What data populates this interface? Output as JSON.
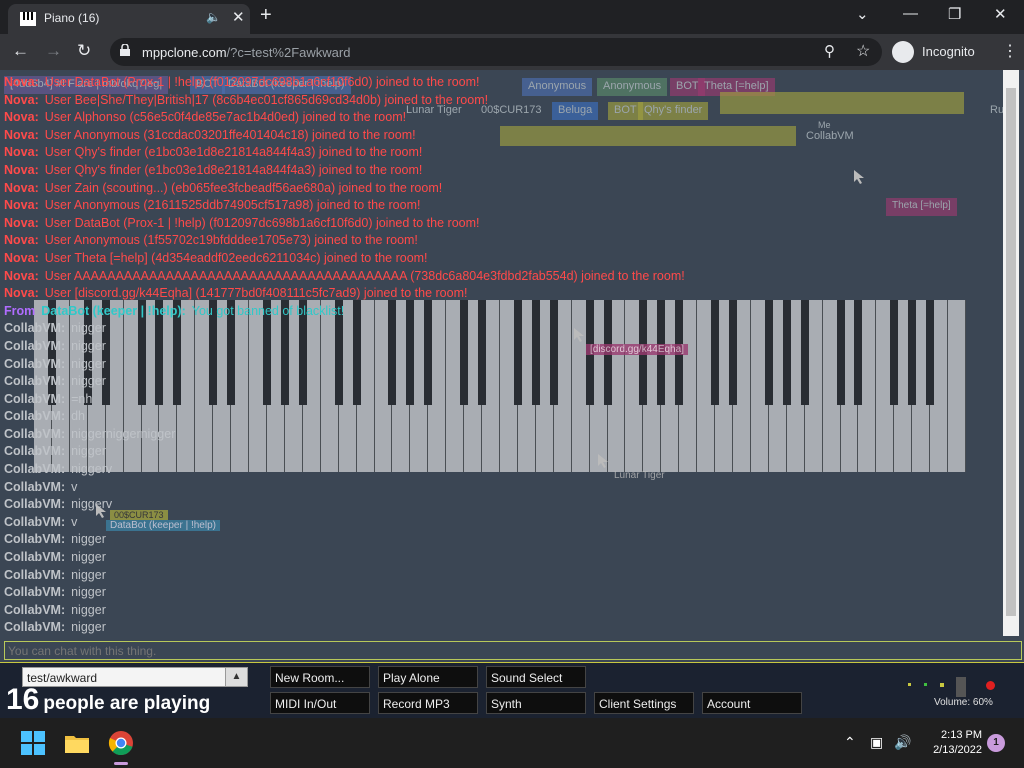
{
  "browser": {
    "tab_title": "Piano (16)",
    "url_host": "mppclone.com",
    "url_path": "/?c=test%2Fawkward",
    "incognito_label": "Incognito",
    "icons": [
      "piano-favicon",
      "audio-mute-icon",
      "close-icon",
      "plus-icon",
      "back-icon",
      "forward-icon",
      "reload-icon",
      "lock-icon",
      "zoom-icon",
      "star-icon",
      "incognito-icon",
      "more-icon",
      "minimize-icon",
      "restore-icon",
      "window-close-icon",
      "chevron-down-icon"
    ]
  },
  "room_labels": [
    "[4dd5b4] #! Flare | mb/okq7|eg|",
    "BOT",
    "DataBot (keeper | !help)",
    "Anonymous",
    "Anonymous",
    "BOT",
    "Theta [=help]",
    "Beluga",
    "BOT",
    "Qhy's finder",
    "Lunar Tiger",
    "00$CUR173",
    "CollabVM",
    "Me",
    "Theta [=help]",
    "[discord.gg/k44Eqha]",
    "Lunar Tiger",
    "DataBot (keeper | !help)",
    "Rule"
  ],
  "chat": [
    {
      "kind": "nova",
      "who": "Nova:",
      "text": "User DataBot (Prox-1 | !help) (f012097dc698b1a6cf10f6d0) joined to the room!"
    },
    {
      "kind": "nova",
      "who": "Nova:",
      "text": "User Bee|She/They|British|17 (8c6b4ec01cf865d69cd34d0b) joined to the room!"
    },
    {
      "kind": "nova",
      "who": "Nova:",
      "text": "User Alphonso (c56e5c0f4de85e7ac1b4d0ed) joined to the room!"
    },
    {
      "kind": "nova",
      "who": "Nova:",
      "text": "User Anonymous (31ccdac03201ffe401404c18) joined to the room!"
    },
    {
      "kind": "nova",
      "who": "Nova:",
      "text": "User Qhy's finder (e1bc03e1d8e21814a844f4a3) joined to the room!"
    },
    {
      "kind": "nova",
      "who": "Nova:",
      "text": "User Qhy's finder (e1bc03e1d8e21814a844f4a3) joined to the room!"
    },
    {
      "kind": "nova",
      "who": "Nova:",
      "text": "User Zain (scouting...) (eb065fee3fcbeadf56ae680a) joined to the room!"
    },
    {
      "kind": "nova",
      "who": "Nova:",
      "text": "User Anonymous (21611525ddb74905cf517a98) joined to the room!"
    },
    {
      "kind": "nova",
      "who": "Nova:",
      "text": "User DataBot (Prox-1 | !help) (f012097dc698b1a6cf10f6d0) joined to the room!"
    },
    {
      "kind": "nova",
      "who": "Nova:",
      "text": "User Anonymous (1f55702c19bfdddee1705e73) joined to the room!"
    },
    {
      "kind": "nova",
      "who": "Nova:",
      "text": "User Theta [=help] (4d354eaddf02eedc6211034c) joined to the room!"
    },
    {
      "kind": "nova",
      "who": "Nova:",
      "text": "User AAAAAAAAAAAAAAAAAAAAAAAAAAAAAAAAAAAAAAAA (738dc6a804e3fdbd2fab554d) joined to the room!"
    },
    {
      "kind": "nova",
      "who": "Nova:",
      "text": "User [discord.gg/k44Eqha] (141777bd0f408111c5fc7ad9) joined to the room!"
    },
    {
      "kind": "from",
      "who": "From",
      "name": "DataBot (keeper | !help):",
      "text": "You got banned of blacklist!"
    },
    {
      "kind": "cvm",
      "who": "CollabVM:",
      "text": "nigger"
    },
    {
      "kind": "cvm",
      "who": "CollabVM:",
      "text": "nigger"
    },
    {
      "kind": "cvm",
      "who": "CollabVM:",
      "text": "nigger"
    },
    {
      "kind": "cvm",
      "who": "CollabVM:",
      "text": "nigger"
    },
    {
      "kind": "cvm",
      "who": "CollabVM:",
      "text": "=nh"
    },
    {
      "kind": "cvm",
      "who": "CollabVM:",
      "text": "dh"
    },
    {
      "kind": "cvm",
      "who": "CollabVM:",
      "text": "niggerniggernigger"
    },
    {
      "kind": "cvm",
      "who": "CollabVM:",
      "text": "nigger"
    },
    {
      "kind": "cvm",
      "who": "CollabVM:",
      "text": "niggerv"
    },
    {
      "kind": "cvm",
      "who": "CollabVM:",
      "text": "v"
    },
    {
      "kind": "cvm",
      "who": "CollabVM:",
      "text": "niggerv"
    },
    {
      "kind": "cvm",
      "who": "CollabVM:",
      "text": "v"
    },
    {
      "kind": "cvm",
      "who": "CollabVM:",
      "text": "nigger"
    },
    {
      "kind": "cvm",
      "who": "CollabVM:",
      "text": "nigger"
    },
    {
      "kind": "cvm",
      "who": "CollabVM:",
      "text": "nigger"
    },
    {
      "kind": "cvm",
      "who": "CollabVM:",
      "text": "nigger"
    },
    {
      "kind": "cvm",
      "who": "CollabVM:",
      "text": "nigger"
    },
    {
      "kind": "cvm",
      "who": "CollabVM:",
      "text": "nigger"
    }
  ],
  "cursor_labels": [
    "[discord.gg/k44Eqha]",
    "Lunar Tiger",
    "DataBot (keeper | !help)",
    "00$CUR173",
    "Theta [=help]"
  ],
  "chat_input_placeholder": "You can chat with this thing.",
  "controls": {
    "room": "test/awkward",
    "player_count": "16",
    "player_label": "people are playing",
    "buttons": [
      "New Room...",
      "Play Alone",
      "Sound Select",
      "MIDI In/Out",
      "Record MP3",
      "Synth",
      "Client Settings",
      "Account"
    ],
    "volume_label": "Volume: 60%",
    "volume": 0.6
  },
  "taskbar": {
    "time": "2:13 PM",
    "date": "2/13/2022",
    "notifications": "1",
    "icons": [
      "windows-start-icon",
      "file-explorer-icon",
      "chrome-icon",
      "chevron-up-icon",
      "network-icon",
      "speaker-icon"
    ]
  },
  "colors": {
    "page_bg": "#3b4654",
    "nova": "#ff4a4a",
    "from": "#b06cff",
    "databot": "#30c9c9",
    "collabvm": "#bfc3c8",
    "accent": "#c8c840"
  }
}
